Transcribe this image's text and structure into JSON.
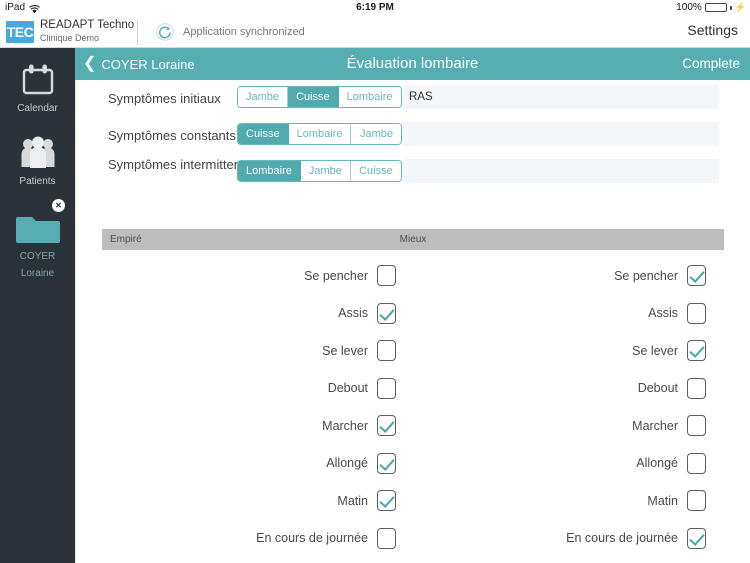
{
  "statusbar": {
    "device": "iPad",
    "wifi_icon": "wifi-icon",
    "time": "6:19 PM",
    "battery_percent": "100%",
    "battery_level": 100,
    "charging": true
  },
  "appheader": {
    "logo_text": "TEC",
    "logo_color": "#4aa8de",
    "brand_name": "READAPT Techno",
    "brand_sub": "Clinique Démo",
    "sync_icon": "sync-refresh-icon",
    "sync_status": "Application synchronized",
    "settings_label": "Settings"
  },
  "sidebar": {
    "background": "#2b3338",
    "items": [
      {
        "label": "Calendar",
        "icon": "calendar-icon"
      },
      {
        "label": "Patients",
        "icon": "people-icon"
      }
    ],
    "open_patient": {
      "icon": "folder-icon",
      "line1": "COYER",
      "line2": "Loraine",
      "close_badge": "✕",
      "folder_color": "#56aeb3"
    }
  },
  "navbar": {
    "accent": "#56aeb3",
    "back_icon": "chevron-left-icon",
    "back_label": "COYER Loraine",
    "title": "Évaluation lombaire",
    "complete_label": "Complete"
  },
  "form": {
    "rows": [
      {
        "label": "Symptômes initiaux",
        "label_lines": 1,
        "segments": [
          {
            "text": "Jambe",
            "active": false
          },
          {
            "text": "Cuisse",
            "active": true
          },
          {
            "text": "Lombaire",
            "active": false
          }
        ],
        "input_value": "RAS",
        "input_placeholder": ""
      },
      {
        "label": "Symptômes constants",
        "label_lines": 1,
        "segments": [
          {
            "text": "Cuisse",
            "active": true
          },
          {
            "text": "Lombaire",
            "active": false
          },
          {
            "text": "Jambe",
            "active": false
          }
        ],
        "input_value": "",
        "input_placeholder": ""
      },
      {
        "label": "Symptômes intermittents",
        "label_lines": 2,
        "segments": [
          {
            "text": "Lombaire",
            "active": true
          },
          {
            "text": "Jambe",
            "active": false
          },
          {
            "text": "Cuisse",
            "active": false
          }
        ],
        "input_value": "",
        "input_placeholder": ""
      }
    ]
  },
  "table": {
    "header_left": "Empiré",
    "header_mid": "Mieux",
    "header_bg": "#bdbdbd",
    "check_color": "#4aa5ae",
    "columns": [
      {
        "name": "Empiré",
        "rows": [
          {
            "label": "Se pencher",
            "checked": false
          },
          {
            "label": "Assis",
            "checked": true
          },
          {
            "label": "Se lever",
            "checked": false
          },
          {
            "label": "Debout",
            "checked": false
          },
          {
            "label": "Marcher",
            "checked": true
          },
          {
            "label": "Allongé",
            "checked": true
          },
          {
            "label": "Matin",
            "checked": true
          },
          {
            "label": "En cours de journée",
            "checked": false
          }
        ]
      },
      {
        "name": "Mieux",
        "rows": [
          {
            "label": "Se pencher",
            "checked": true
          },
          {
            "label": "Assis",
            "checked": false
          },
          {
            "label": "Se lever",
            "checked": true
          },
          {
            "label": "Debout",
            "checked": false
          },
          {
            "label": "Marcher",
            "checked": false
          },
          {
            "label": "Allongé",
            "checked": false
          },
          {
            "label": "Matin",
            "checked": false
          },
          {
            "label": "En cours de journée",
            "checked": true
          }
        ]
      }
    ]
  }
}
